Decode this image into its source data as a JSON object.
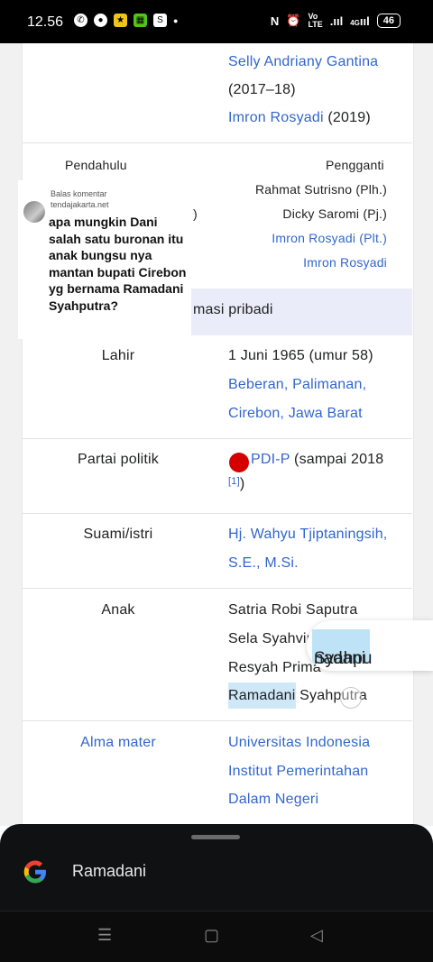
{
  "status_bar": {
    "time": "12.56",
    "network_label": "4G",
    "battery": "46"
  },
  "infobox": {
    "top_entries": [
      {
        "name": "Selly Andriany Gantina",
        "suffix": ""
      },
      {
        "name": "",
        "suffix": "(2017–18)"
      },
      {
        "name": "Imron Rosyadi",
        "suffix": "(2019)"
      }
    ],
    "predecessor_label": "Pendahulu",
    "predecessor_fragment": ")",
    "successor_label": "Pengganti",
    "successors": [
      {
        "name": "Rahmat Sutrisno (Plh.)",
        "link": false
      },
      {
        "name": "Dicky Saromi (Pj.)",
        "link": false
      },
      {
        "name": "Imron Rosyadi (Plt.)",
        "link": true
      },
      {
        "name": "Imron Rosyadi",
        "link": true
      }
    ],
    "section_header": "masi pribadi",
    "rows": {
      "born": {
        "label": "Lahir",
        "date": "1 Juni 1965 (umur 58)",
        "place_line1": "Beberan, Palimanan,",
        "place_line2": "Cirebon, Jawa Barat"
      },
      "party": {
        "label": "Partai politik",
        "party": "PDI-P",
        "party_rest": " (sampai 2018",
        "ref": "[1]",
        "close": ")"
      },
      "spouse": {
        "label": "Suami/istri",
        "line1": "Hj. Wahyu Tjiptaningsih,",
        "line2": "S.E., M.Si."
      },
      "children": {
        "label": "Anak",
        "items": [
          "Satria Robi Saputra",
          "Sela Syahvir",
          "Resyah Prima"
        ],
        "last_highlight": "Ramadani",
        "last_rest": " Syahputra"
      },
      "alma_mater": {
        "label": "Alma mater",
        "line1": "Universitas Indonesia",
        "line2": "Institut Pemerintahan",
        "line3": "Dalam Negeri"
      }
    }
  },
  "magnifier_popup": {
    "highlight": "nadani",
    "rest": " Syahpu"
  },
  "comment_overlay": {
    "source_line1": "Balas komentar",
    "source_line2": "tendajakarta.net",
    "text": "apa mungkin Dani salah satu buronan itu anak bungsu nya mantan bupati Cirebon yg bernama Ramadani Syahputra?"
  },
  "search_sheet": {
    "query": "Ramadani"
  },
  "colors": {
    "link": "#3366cc",
    "section_bg": "#eaecf9",
    "highlight": "#cfe8f8",
    "party_red": "#d40000"
  }
}
